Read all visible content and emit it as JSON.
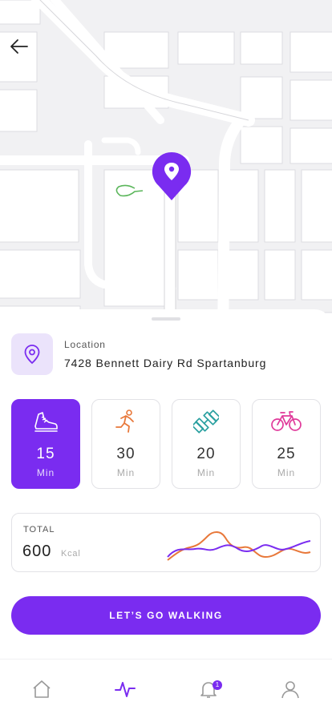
{
  "colors": {
    "accent": "#7a2cf0",
    "accent_light": "#ebe3fb",
    "runner": "#e8783a",
    "dumbbell": "#2aa0a0",
    "bike": "#e0399a",
    "map_route": "#5bb65b"
  },
  "map": {
    "back_icon": "arrow-left-icon",
    "pin_icon": "location-pin-icon"
  },
  "location": {
    "icon": "location-pin-icon",
    "label": "Location",
    "address": "7428 Bennett Dairy Rd Spartanburg"
  },
  "activities": [
    {
      "icon": "walking-shoe-icon",
      "value": "15",
      "unit": "Min",
      "selected": true
    },
    {
      "icon": "running-person-icon",
      "value": "30",
      "unit": "Min",
      "selected": false
    },
    {
      "icon": "dumbbell-icon",
      "value": "20",
      "unit": "Min",
      "selected": false
    },
    {
      "icon": "bicycle-icon",
      "value": "25",
      "unit": "Min",
      "selected": false
    }
  ],
  "total": {
    "label": "TOTAL",
    "value": "600",
    "unit": "Kcal"
  },
  "cta": {
    "label": "LET’S GO WALKING"
  },
  "bottom_nav": {
    "items": [
      {
        "icon": "home-icon",
        "active": false
      },
      {
        "icon": "activity-pulse-icon",
        "active": true
      },
      {
        "icon": "bell-icon",
        "active": false,
        "badge": "1"
      },
      {
        "icon": "profile-icon",
        "active": false
      }
    ]
  }
}
